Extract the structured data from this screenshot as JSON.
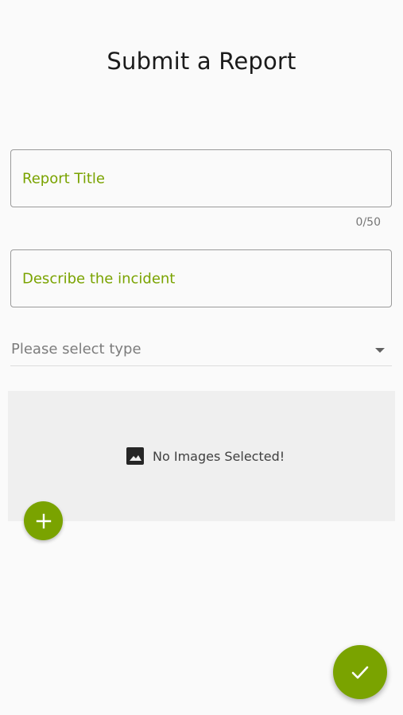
{
  "page": {
    "title": "Submit a Report"
  },
  "form": {
    "title_field": {
      "label": "Report Title",
      "counter": "0/50"
    },
    "description_field": {
      "label": "Describe the incident"
    },
    "type_select": {
      "placeholder": "Please select type"
    }
  },
  "images": {
    "empty_message": "No Images Selected!"
  },
  "icons": {
    "image": "image-icon",
    "add": "plus-icon",
    "submit": "check-icon",
    "dropdown": "chevron-down-icon"
  },
  "colors": {
    "accent": "#7aa300",
    "text_primary": "#1b1b1b",
    "text_secondary": "#7c7c7c",
    "panel": "#efefef"
  }
}
